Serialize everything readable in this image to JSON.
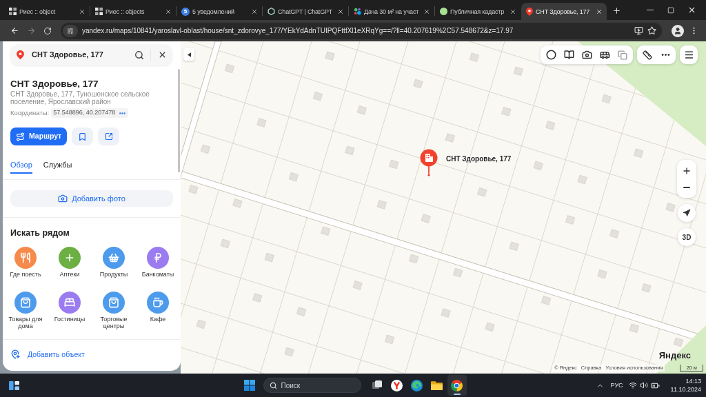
{
  "browser": {
    "tabs": [
      {
        "title": "Риес :: object",
        "selected": false
      },
      {
        "title": "Риес :: objects",
        "selected": false
      },
      {
        "title": "5 уведомлений",
        "badge": "5",
        "selected": false
      },
      {
        "title": "ChatGPT | ChatGPT",
        "selected": false
      },
      {
        "title": "Дача 30 м² на участ",
        "selected": false
      },
      {
        "title": "Публичная кадастр",
        "selected": false
      },
      {
        "title": "СНТ Здоровье, 177",
        "selected": true
      }
    ],
    "address_bar": {
      "url": "yandex.ru/maps/10841/yaroslavl-oblast/house/snt_zdorovye_177/YEkYdAdnTUIPQFttfXl1eXRqYg==/?ll=40.207619%2C57.548672&z=17.97",
      "forward_disabled": true
    }
  },
  "sidebar": {
    "search": {
      "value": "СНТ Здоровье, 177"
    },
    "place": {
      "title": "СНТ Здоровье, 177",
      "address": "СНТ Здоровье, 177, Туношенское сельское поселение, Ярославский район",
      "coordinates_label": "Координаты:",
      "coordinates": "57.548896, 40.207478"
    },
    "route_button": "Маршрут",
    "tabs": [
      {
        "label": "Обзор",
        "selected": true
      },
      {
        "label": "Службы",
        "selected": false
      }
    ],
    "add_photo": "Добавить фото",
    "nearby": {
      "heading": "Искать рядом",
      "categories": [
        {
          "label": "Где поесть",
          "color": "#f58a4b"
        },
        {
          "label": "Аптеки",
          "color": "#6cb043"
        },
        {
          "label": "Продукты",
          "color": "#4d9bec"
        },
        {
          "label": "Банкоматы",
          "color": "#9b7cf0"
        },
        {
          "label": "Товары для дома",
          "color": "#4d9bec"
        },
        {
          "label": "Гостиницы",
          "color": "#9b7cf0"
        },
        {
          "label": "Торговые центры",
          "color": "#4d9bec"
        },
        {
          "label": "Кафе",
          "color": "#4d9bec"
        }
      ]
    },
    "add_object": "Добавить объект"
  },
  "map": {
    "pin_label": "СНТ Здоровье, 177",
    "view_3d": "3D",
    "attribution": [
      "© Яндекс",
      "Справка",
      "Условия использования"
    ],
    "logo": "Яндекс",
    "scale": "20 м"
  },
  "taskbar": {
    "search": "Поиск",
    "apps": [
      {
        "active": false
      },
      {
        "active": false
      },
      {
        "active": false
      },
      {
        "active": false
      },
      {
        "active": true
      }
    ],
    "language": "РУС",
    "time": "14:13",
    "date": "11.10.2024"
  }
}
